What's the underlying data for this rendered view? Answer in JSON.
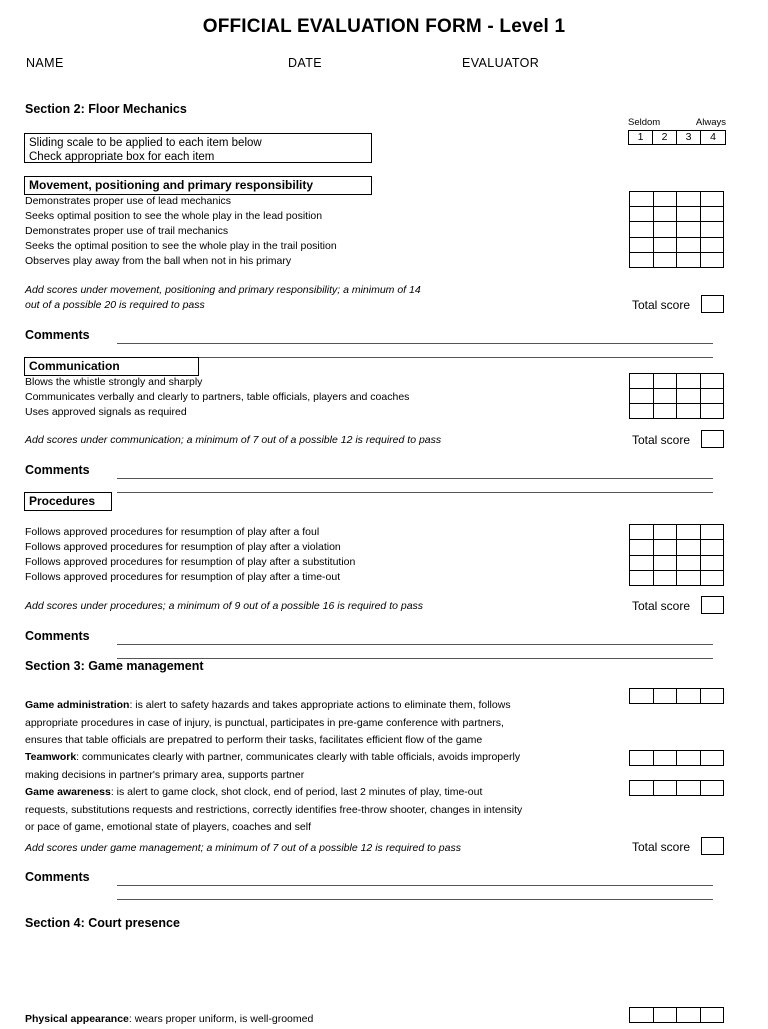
{
  "document": {
    "title": "OFFICIAL EVALUATION FORM - Level 1"
  },
  "header_fields": [
    {
      "label": "NAME"
    },
    {
      "label": "DATE"
    },
    {
      "label": "EVALUATOR"
    }
  ],
  "scale": {
    "low_label": "Seldom",
    "high_label": "Always",
    "values": [
      "1",
      "2",
      "3",
      "4"
    ]
  },
  "instructions": {
    "line1": "Sliding scale to be applied to each item below",
    "line2": "Check appropriate box for each item"
  },
  "labels": {
    "comments": "Comments",
    "total_score": "Total score"
  },
  "sections": [
    {
      "heading": "Section 2:  Floor Mechanics",
      "categories": [
        {
          "name": "Movement, positioning and primary responsibility",
          "criteria": [
            "Demonstrates proper use of lead mechanics",
            "Seeks optimal position to see the whole play in the lead position",
            "Demonstrates proper use of trail mechanics",
            "Seeks the optimal position to see the whole play in the trail position",
            "Observes play away from the ball when not in his primary"
          ],
          "note_line1": "Add scores under movement, positioning and primary responsibility; a minimum of 14",
          "note_line2": "out of a possible 20 is required to pass",
          "rows": 5,
          "cols": 4
        },
        {
          "name": "Communication",
          "criteria": [
            "Blows the whistle strongly and sharply",
            "Communicates verbally and clearly to partners, table officials, players and coaches",
            "Uses approved signals as required"
          ],
          "note_line1": "Add scores under communication; a minimum of 7 out of a possible 12 is required to pass",
          "note_line2": "",
          "rows": 3,
          "cols": 4
        },
        {
          "name": "Procedures",
          "criteria": [
            "Follows approved procedures for resumption of play after a foul",
            "Follows approved procedures for resumption of play after a violation",
            "Follows approved procedures for resumption of play after a substitution",
            "Follows approved procedures for resumption of play after a time-out"
          ],
          "note_line1": "Add scores under procedures; a minimum of 9 out of a possible 16 is required to pass",
          "note_line2": "",
          "rows": 4,
          "cols": 4
        }
      ]
    },
    {
      "heading": "Section 3: Game management",
      "items": [
        {
          "term": "Game administration",
          "text": ": is alert to safety hazards and takes appropriate actions to eliminate them, follows appropriate procedures in case of injury, is punctual, participates in pre-game conference with partners, ensures that table officials are prepatred to perform their tasks, facilitates efficient flow of the game"
        },
        {
          "term": "Teamwork",
          "text": ": communicates clearly with partner, communicates clearly with table officials, avoids improperly making decisions in partner's primary area, supports partner"
        },
        {
          "term": "Game awareness",
          "text": ":  is alert to game clock, shot clock, end of period, last 2 minutes of play, time-out requests, substitutions requests and restrictions, correctly identifies free-throw shooter, changes in intensity or pace of game, emotional state of players, coaches and self"
        }
      ],
      "note_line1": "Add scores under game management; a minimum of 7 out of a possible 12 is required to pass"
    },
    {
      "heading": "Section 4: Court presence",
      "items": [
        {
          "term": "Physical appearance",
          "text": ": wears proper uniform, is well-groomed"
        }
      ]
    }
  ]
}
